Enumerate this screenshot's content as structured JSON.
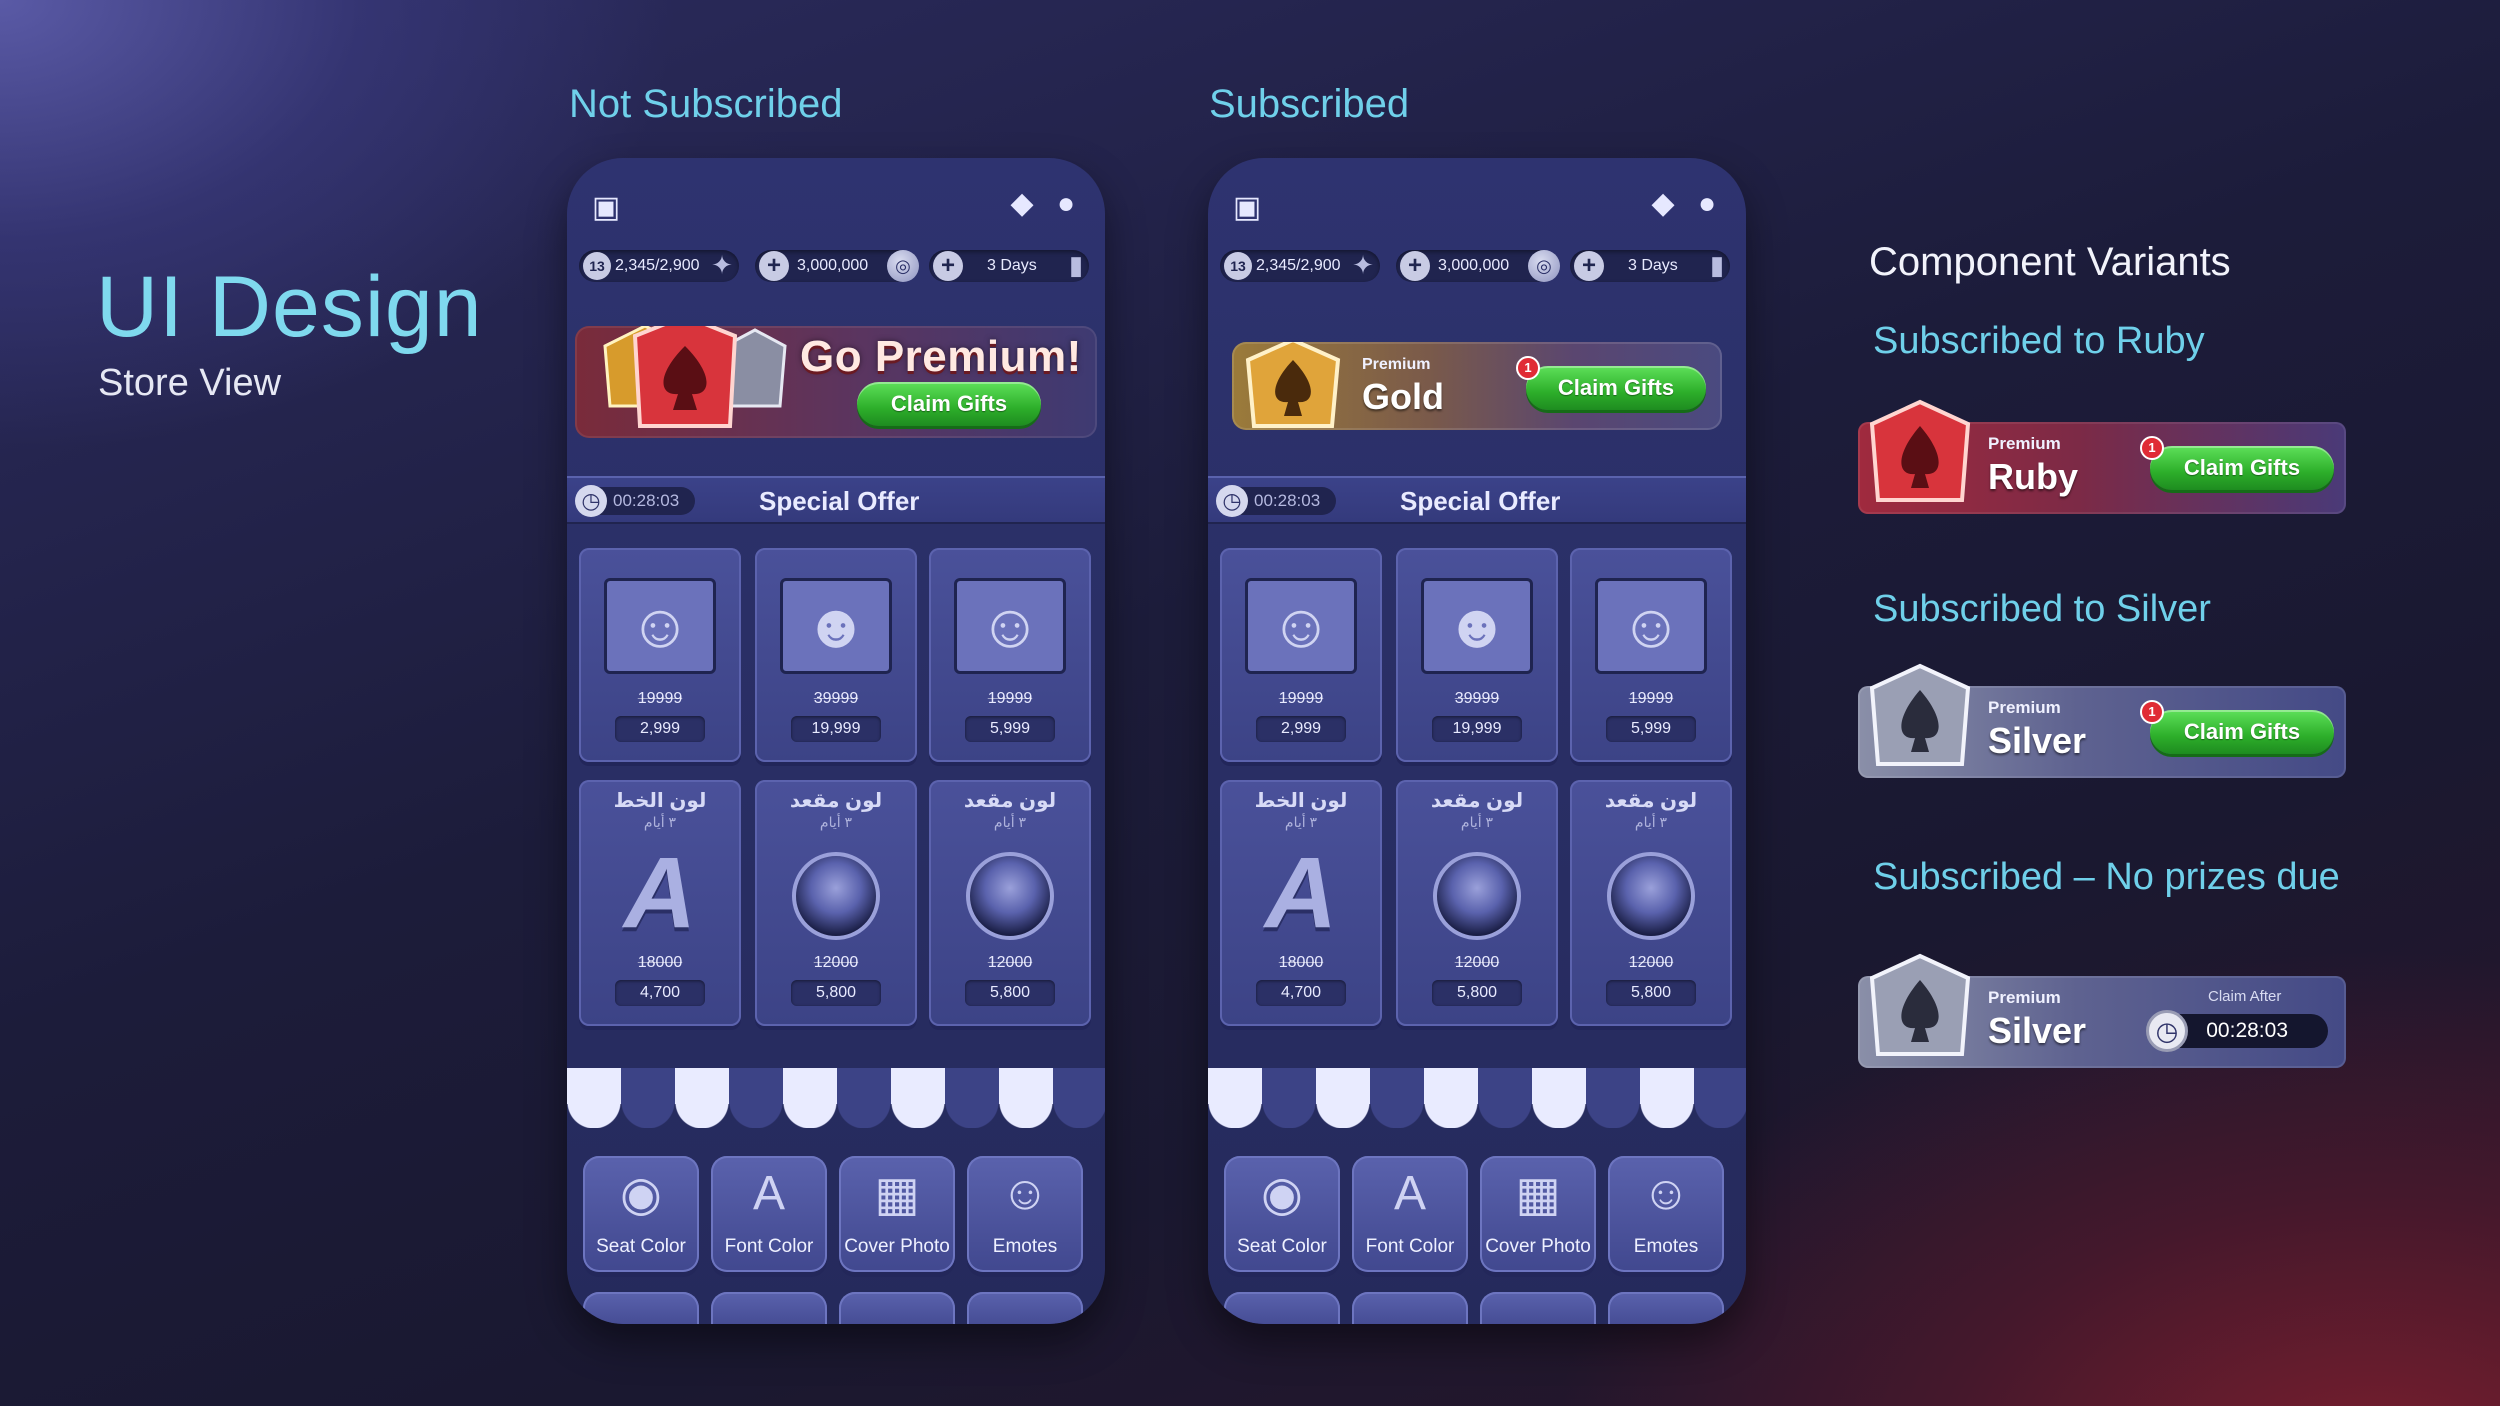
{
  "page": {
    "title": "UI Design",
    "subtitle": "Store View"
  },
  "columns": {
    "not_subscribed": "Not Subscribed",
    "subscribed": "Subscribed"
  },
  "phone": {
    "top_left_icon": "profile-card-icon",
    "top_right_icons": [
      "diamond-icon",
      "user-icon"
    ],
    "level": "13",
    "xp": "2,345/2,900",
    "coins": "3,000,000",
    "subscription_days": "3 Days",
    "timer": "00:28:03",
    "special_offer": "Special Offer",
    "cards_row1": [
      {
        "avatar": "old-man-avatar",
        "old_price": "19999",
        "price": "2,999"
      },
      {
        "avatar": "mustache-man-avatar",
        "old_price": "39999",
        "price": "19,999"
      },
      {
        "avatar": "jester-avatar",
        "old_price": "19999",
        "price": "5,999"
      }
    ],
    "cards_row2": [
      {
        "title": "لون الخط",
        "duration": "٣ أيام",
        "icon": "font-a-icon",
        "old_price": "18000",
        "price": "4,700"
      },
      {
        "title": "لون مقعد",
        "duration": "٣ أيام",
        "icon": "seat-circle-icon",
        "old_price": "12000",
        "price": "5,800"
      },
      {
        "title": "لون مقعد",
        "duration": "٣ أيام",
        "icon": "seat-circle-icon",
        "old_price": "12000",
        "price": "5,800"
      }
    ],
    "categories": [
      {
        "label": "Seat Color",
        "icon": "seat-icon"
      },
      {
        "label": "Font Color",
        "icon": "font-icon"
      },
      {
        "label": "Cover Photo",
        "icon": "cover-photo-icon"
      },
      {
        "label": "Emotes",
        "icon": "emotes-icon"
      }
    ]
  },
  "not_subscribed_banner": {
    "headline": "Go Premium!",
    "button": "Claim Gifts"
  },
  "subscribed_banner": {
    "tier_label": "Premium",
    "tier": "Gold",
    "button": "Claim Gifts",
    "badge": "1"
  },
  "variants": {
    "heading": "Component Variants",
    "ruby": {
      "title": "Subscribed to Ruby",
      "tier_label": "Premium",
      "tier": "Ruby",
      "button": "Claim Gifts",
      "badge": "1"
    },
    "silver": {
      "title": "Subscribed to Silver",
      "tier_label": "Premium",
      "tier": "Silver",
      "button": "Claim Gifts",
      "badge": "1"
    },
    "no_prizes": {
      "title": "Subscribed – No prizes due",
      "tier_label": "Premium",
      "tier": "Silver",
      "claim_after": "Claim After",
      "timer": "00:28:03"
    }
  },
  "colors": {
    "accent": "#6fd0ea",
    "claim_green": "#2dae2a",
    "ruby": "#a02a3e",
    "gold": "#c99a3a",
    "silver": "#9a9fb4"
  }
}
